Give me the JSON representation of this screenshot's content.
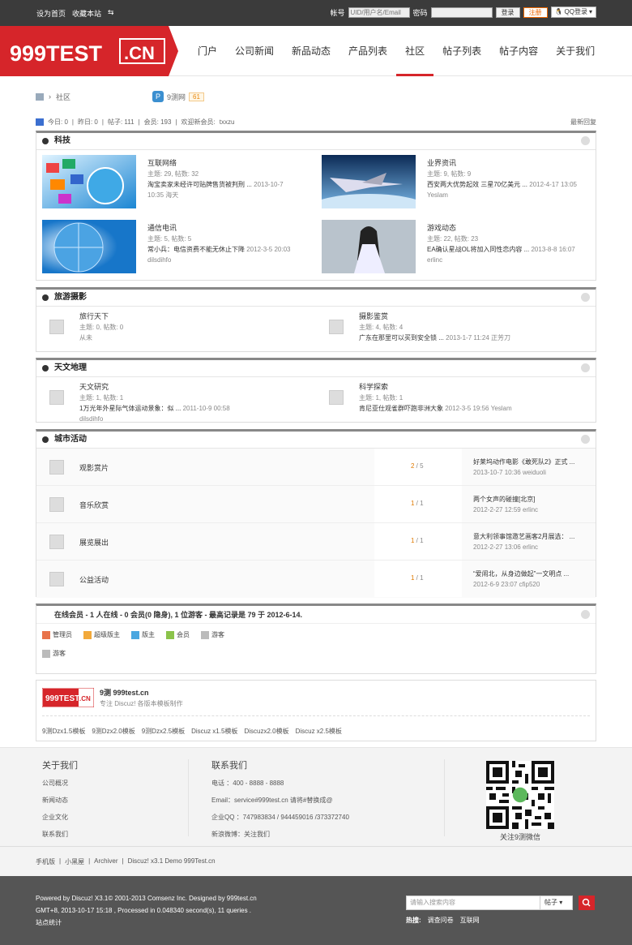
{
  "topbar": {
    "set_home": "设为首页",
    "bookmark": "收藏本站",
    "account_label": "帐号",
    "account_placeholder": "UID/用户名/Email",
    "password_label": "密码",
    "login_button": "登录",
    "register_button": "注册",
    "qq_login": "QQ登录"
  },
  "logo": {
    "text": "999TEST",
    "suffix": ".CN"
  },
  "nav": [
    "门户",
    "公司新闻",
    "新品动态",
    "产品列表",
    "社区",
    "帖子列表",
    "帖子内容",
    "关于我们"
  ],
  "breadcrumb": {
    "current": "社区",
    "site": "9测网",
    "count": "61"
  },
  "stats": {
    "today": "今日: 0",
    "yesterday": "昨日: 0",
    "posts": "帖子: 111",
    "members": "会员: 193",
    "welcome": "欢迎新会员:",
    "newest": "txxzu",
    "latest_reply": "最新回复"
  },
  "sections": [
    {
      "title": "科技",
      "forums": [
        {
          "name": "互联网络",
          "meta": "主题: 29, 帖数: 32",
          "last": "淘宝卖家未经许可贴牌售货被判刑 ...",
          "date": "2013-10-7",
          "extra": "10:35 海天"
        },
        {
          "name": "业界资讯",
          "meta": "主题: 9, 帖数: 9",
          "last": "西安两大优势起效 三星70亿美元 ...",
          "date": "2012-4-17 13:05",
          "extra": "Yeslam"
        },
        {
          "name": "通信电讯",
          "meta": "主题: 5, 帖数: 5",
          "last": "常小兵：电信资费不能无休止下降",
          "date": "2012-3-5 20:03",
          "extra": "dilsdihfo"
        },
        {
          "name": "游戏动态",
          "meta": "主题: 22, 帖数: 23",
          "last": "EA确认星战OL将加入同性恋内容 ...",
          "date": "2013-8-8 16:07",
          "extra": "erlinc"
        }
      ]
    },
    {
      "title": "旅游摄影",
      "forums": [
        {
          "name": "旅行天下",
          "meta": "主题: 0, 帖数: 0",
          "last": "从未",
          "date": "",
          "extra": ""
        },
        {
          "name": "摄影鉴赏",
          "meta": "主题: 4, 帖数: 4",
          "last": "广东在那里可以买到安全锁 ...",
          "date": "2013-1-7 11:24 正芳刀",
          "extra": ""
        }
      ]
    },
    {
      "title": "天文地理",
      "forums": [
        {
          "name": "天文研究",
          "meta": "主题: 1, 帖数: 1",
          "last": "1万光年外星际气体运动景象：似 ...",
          "date": "2011-10-9 00:58 dilsdihfo",
          "extra": ""
        },
        {
          "name": "科学探索",
          "meta": "主题: 1, 帖数: 1",
          "last": "肯尼亚仕观雀群吓跑非洲大象",
          "date": "2012-3-5 19:56 Yeslam",
          "extra": ""
        }
      ]
    },
    {
      "title": "城市活动",
      "forums": [
        {
          "name": "观影赏片",
          "a": "2",
          "b": "5",
          "last": "好莱坞动作电影《敢死队2》正式 ...",
          "date": "2013-10-7 10:36 weiduoli"
        },
        {
          "name": "音乐欣赏",
          "a": "1",
          "b": "1",
          "last": "两个女声的碰撞[北京]",
          "date": "2012-2-27 12:59 erlinc"
        },
        {
          "name": "展览展出",
          "a": "1",
          "b": "1",
          "last": "意大利领事馆邀艺画客2月展选： ...",
          "date": "2012-2-27 13:06 erlinc"
        },
        {
          "name": "公益活动",
          "a": "1",
          "b": "1",
          "last": "“爱闹北，从身边做起”一文明点 ...",
          "date": "2012-6-9 23:07 cfip520"
        }
      ]
    }
  ],
  "online": {
    "title": "在线会员 - 1 人在线 - 0 会员(0 隐身), 1 位游客 - 最高记录是 79 于 2012-6-14.",
    "legend": [
      "管理员",
      "超级版主",
      "版主",
      "会员",
      "游客"
    ],
    "guest": "游客",
    "legend_colors": [
      "#e8734a",
      "#f2a93b",
      "#4aa7e0",
      "#8bc34a",
      "#bbbbbb"
    ]
  },
  "brand": {
    "name": "9测 999test.cn",
    "desc": "专注 Discuz! 各版本模板制作",
    "links": [
      "9测Dzx1.5模板",
      "9测Dzx2.0模板",
      "9测Dzx2.5模板",
      "Discuz x1.5模板",
      "Discuzx2.0模板",
      "Discuz x2.5模板"
    ]
  },
  "footer": {
    "about_title": "关于我们",
    "about": [
      "公司概况",
      "新闻动态",
      "企业文化",
      "联系我们"
    ],
    "contact_title": "联系我们",
    "contact": [
      "电话 ：400 - 8888 - 8888",
      "Email：service#999test.cn 请将#替换成@",
      "企业QQ ：747983834 / 944459016 /373372740",
      "新浪微博：关注我们"
    ],
    "qr_caption": "关注9测微信"
  },
  "bottom_links": [
    "手机版",
    "小黑屋",
    "Archiver",
    "Discuz! x3.1 Demo 999Test.cn"
  ],
  "copyright": {
    "line1": "Powered by Discuz! X3.1© 2001-2013 Comsenz Inc. Designed by 999test.cn",
    "line2": "GMT+8, 2013-10-17 15:18 , Processed in 0.048340 second(s), 11 queries .",
    "line3": "站点统计"
  },
  "search": {
    "placeholder": "请输入搜索内容",
    "select": "帖子",
    "hot_label": "热搜:",
    "hot": [
      "调查问卷",
      "互联网"
    ]
  }
}
